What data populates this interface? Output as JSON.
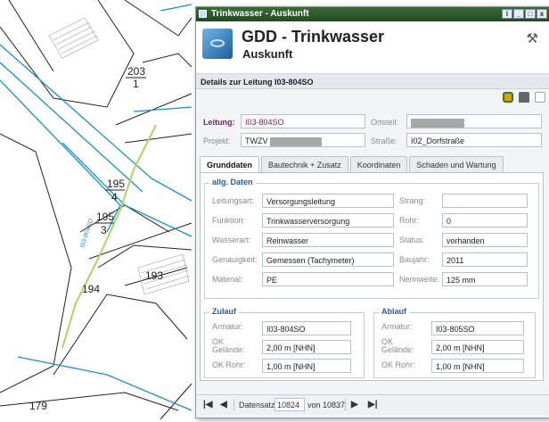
{
  "map": {
    "parcel_labels": [
      "203",
      "1",
      "195",
      "4",
      "195",
      "3",
      "193",
      "194",
      "179"
    ],
    "pipe_label": "I03-804SO"
  },
  "window": {
    "title": "Trinkwasser - Auskunft",
    "buttons": [
      "i",
      "_",
      "□",
      "x"
    ]
  },
  "header": {
    "title": "GDD - Trinkwasser",
    "subtitle": "Auskunft",
    "tools_icon": "tools-icon"
  },
  "details": {
    "title": "Details zur Leitung I03-804SO"
  },
  "top_fields": {
    "leitung_label": "Leitung:",
    "leitung_value": "I03-804SO",
    "ortsteil_label": "Ortsteil:",
    "projekt_label": "Projekt:",
    "projekt_value": "TWZV",
    "strasse_label": "Straße:",
    "strasse_value": "I02_Dorfstraße"
  },
  "tabs": [
    "Grunddaten",
    "Bautechnik + Zusatz",
    "Koordinaten",
    "Schaden und Wartung"
  ],
  "allg": {
    "legend": "allg. Daten",
    "leitungsart_label": "Leitungsart:",
    "leitungsart": "Versorgungsleitung",
    "funktion_label": "Funktion:",
    "funktion": "Trinkwasserversorgung",
    "wasserart_label": "Wasserart:",
    "wasserart": "Reinwasser",
    "genauigkeit_label": "Genauigkeit:",
    "genauigkeit": "Gemessen (Tachymeter)",
    "material_label": "Material:",
    "material": "PE",
    "strang_label": "Strang:",
    "strang": "",
    "rohr_label": "Rohr:",
    "rohr": "0",
    "status_label": "Status:",
    "status": "vorhanden",
    "baujahr_label": "Baujahr:",
    "baujahr": "2011",
    "nennweite_label": "Nennweite:",
    "nennweite": "125 mm"
  },
  "zulauf": {
    "legend": "Zulauf",
    "armatur_label": "Armatur:",
    "armatur": "I03-804SO",
    "ok_gelaende_label_1": "OK",
    "ok_gelaende_label_2": "Gelände:",
    "ok_gelaende": "2,00 m [NHN]",
    "ok_rohr_label": "OK Rohr:",
    "ok_rohr": "1,00 m [NHN]"
  },
  "ablauf": {
    "legend": "Ablauf",
    "armatur_label": "Armatur:",
    "armatur": "I03-805SO",
    "ok_gelaende_label_1": "OK",
    "ok_gelaende_label_2": "Gelände:",
    "ok_gelaende": "2,00 m [NHN]",
    "ok_rohr_label": "OK Rohr:",
    "ok_rohr": "1,00 m [NHN]"
  },
  "navigation": {
    "first": "|◀",
    "prev": "◀",
    "record_label": "Datensatz",
    "current": "10824",
    "of_label": "von 10837",
    "next": "▶",
    "last": "▶|"
  }
}
